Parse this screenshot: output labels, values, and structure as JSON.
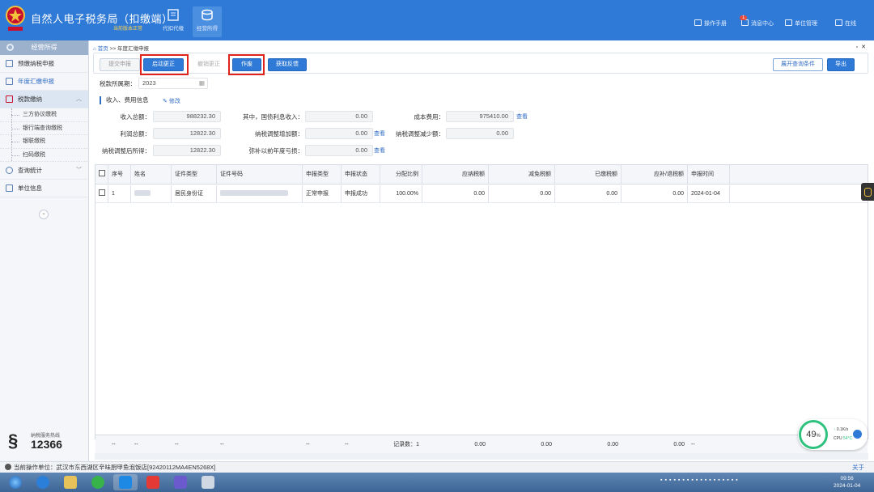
{
  "header": {
    "title": "自然人电子税务局（扣缴端）",
    "subtitle": "当前版本正常",
    "tabs": [
      {
        "label": "代扣代缴",
        "icon": "withholding-icon",
        "active": false
      },
      {
        "label": "经营所得",
        "icon": "business-income-icon",
        "active": true
      }
    ],
    "right": {
      "manual": "操作手册",
      "messages": "消息中心",
      "messages_badge": "1",
      "unit_admin": "单位管理",
      "online": "在线"
    }
  },
  "sidebar": {
    "section_title": "经营所得",
    "items": [
      {
        "label": "预缴纳税申报"
      },
      {
        "label": "年度汇缴申报",
        "current": true
      },
      {
        "label": "税款缴纳",
        "expanded": true
      }
    ],
    "sub_items": [
      "三方协议缴税",
      "银行端查询缴税",
      "银联缴税",
      "扫码缴税"
    ],
    "items_after": [
      {
        "label": "查询统计"
      },
      {
        "label": "单位信息"
      }
    ],
    "hotline_label": "纳税服务热线",
    "hotline_number": "12366"
  },
  "breadcrumb": {
    "home": "首页",
    "separator": ">>",
    "current": "年度汇缴申报"
  },
  "toolbar": {
    "submit": "提交申报",
    "start_correction": "启动更正",
    "cancel_correction": "撤销更正",
    "void": "作废",
    "get_feedback": "获取反馈",
    "expand_search": "展开查询条件",
    "export": "导出"
  },
  "period": {
    "label": "税款所属期：",
    "value": "2023"
  },
  "section": {
    "title": "收入、费用信息",
    "edit": "修改"
  },
  "fields": {
    "total_income": {
      "label": "收入总额：",
      "value": "988232.30"
    },
    "treasury_interest": {
      "label": "其中，国债利息收入：",
      "value": "0.00"
    },
    "cost": {
      "label": "成本费用：",
      "value": "975410.00",
      "link": "查看"
    },
    "total_profit": {
      "label": "利润总额：",
      "value": "12822.30"
    },
    "tax_adj_increase": {
      "label": "纳税调整增加额：",
      "value": "0.00",
      "link": "查看"
    },
    "tax_adj_decrease": {
      "label": "纳税调整减少额：",
      "value": "0.00"
    },
    "adjusted_income": {
      "label": "纳税调整后所得：",
      "value": "12822.30"
    },
    "prior_loss": {
      "label": "弥补以前年度亏损：",
      "value": "0.00",
      "link": "查看"
    }
  },
  "table": {
    "columns": [
      "序号",
      "姓名",
      "证件类型",
      "证件号码",
      "申报类型",
      "申报状态",
      "分配比例",
      "应纳税额",
      "减免税额",
      "已缴税额",
      "应补/退税额",
      "申报时间"
    ],
    "rows": [
      {
        "seq": "1",
        "name": "",
        "id_type": "居民身份证",
        "id_no": "",
        "decl_type": "正常申报",
        "decl_status": "申报成功",
        "ratio": "100.00%",
        "tax_payable": "0.00",
        "tax_relief": "0.00",
        "tax_paid": "0.00",
        "tax_due": "0.00",
        "date": "2024-01-04"
      }
    ],
    "footer": {
      "dash": "--",
      "record_count": "记录数：1",
      "tax_payable": "0.00",
      "tax_relief": "0.00",
      "tax_paid": "0.00",
      "tax_due": "0.00"
    }
  },
  "monitor": {
    "percent": "49",
    "unit": "%",
    "net": "0.1K/s",
    "cpu_label": "CPU",
    "cpu_temp": "54°C"
  },
  "status": {
    "label": "当前操作单位：武汉市东西湖区辛味厨甲鱼泡饭店[92420112MA4EN5268X]",
    "about": "关于"
  },
  "taskbar": {
    "time": "09:56",
    "date": "2024-01-04"
  },
  "colors": {
    "header_blue": "#2f7ad6",
    "highlight_red": "#e0231c",
    "link_blue": "#2f6cc4"
  }
}
